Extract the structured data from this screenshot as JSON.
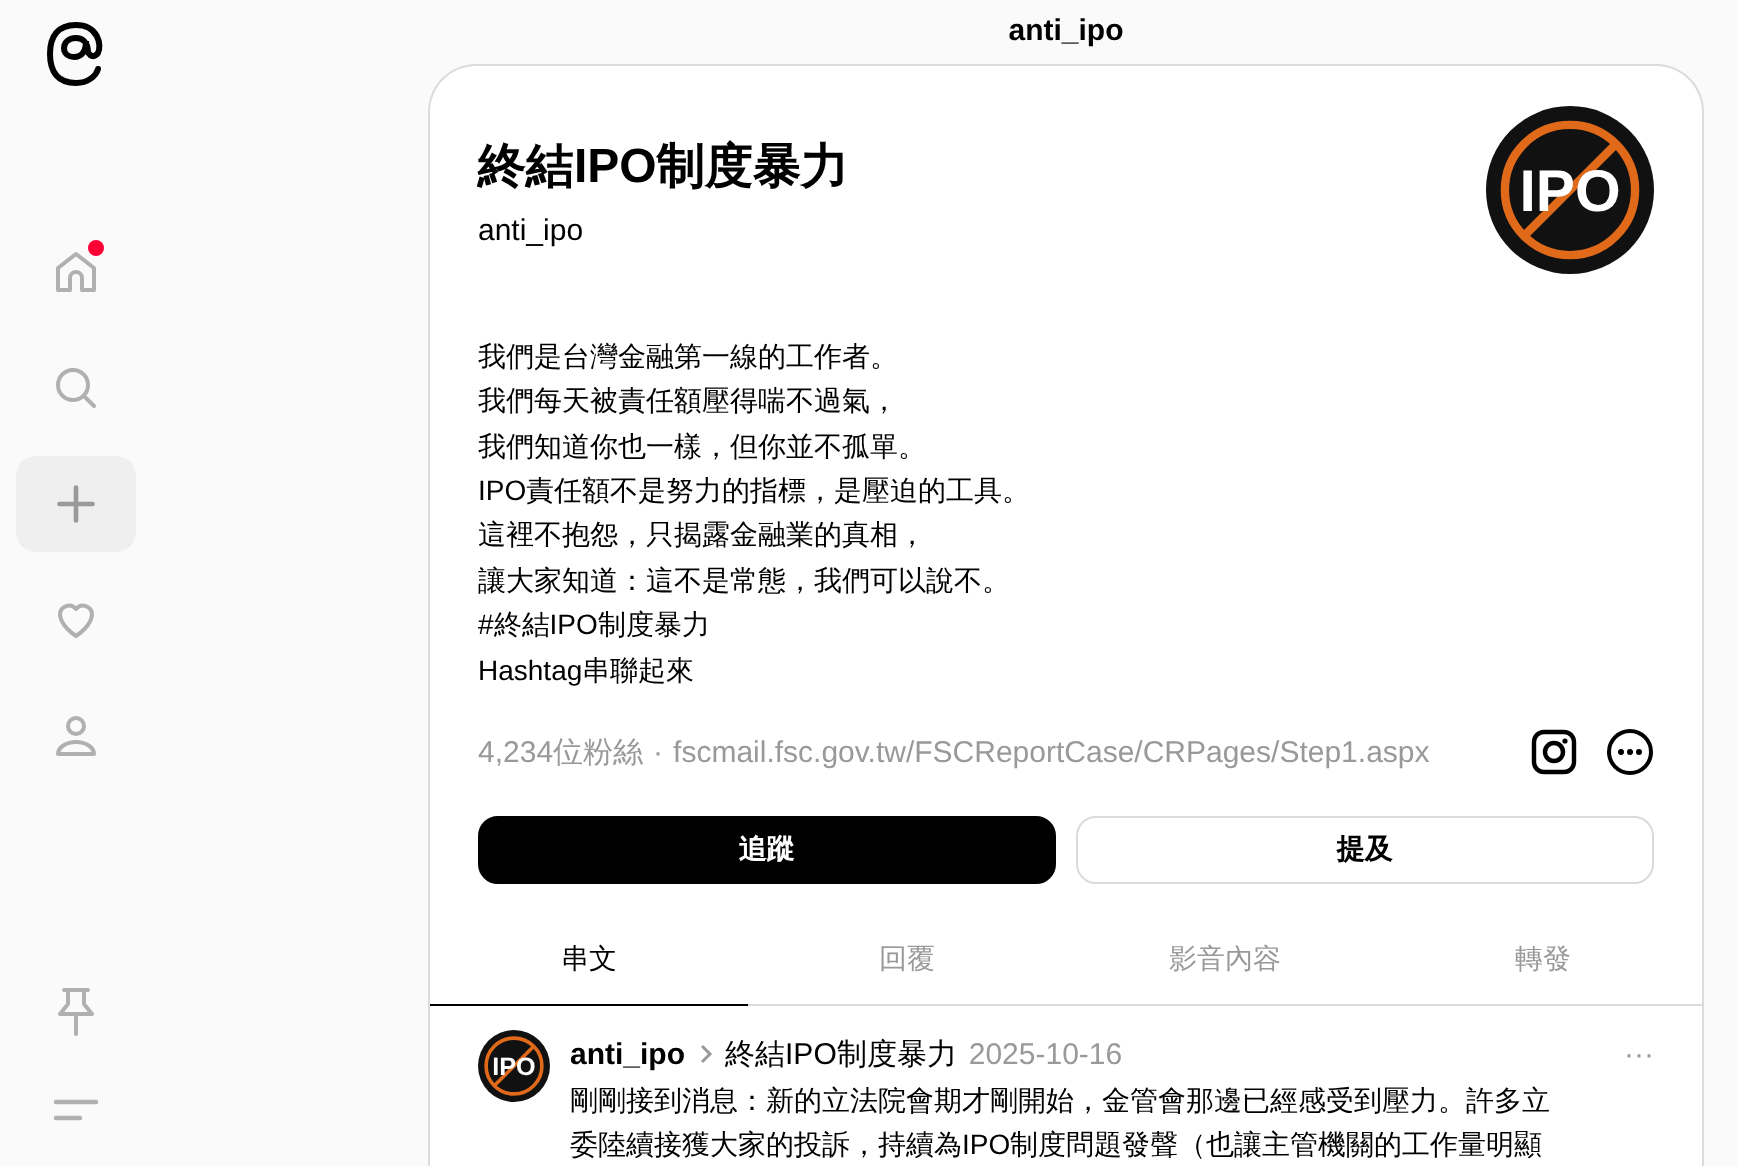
{
  "header": {
    "title": "anti_ipo"
  },
  "nav": [
    {
      "kind": "home",
      "notification": true,
      "hovered": false
    },
    {
      "kind": "search",
      "notification": false,
      "hovered": false
    },
    {
      "kind": "create",
      "notification": false,
      "hovered": true
    },
    {
      "kind": "activity",
      "notification": false,
      "hovered": false
    },
    {
      "kind": "profile",
      "notification": false,
      "hovered": false
    }
  ],
  "profile": {
    "name": "終結IPO制度暴力",
    "handle": "anti_ipo",
    "avatar_text": "IPO",
    "bio": [
      "我們是台灣金融第一線的工作者。",
      "我們每天被責任額壓得喘不過氣，",
      "我們知道你也一樣，但你並不孤單。",
      "IPO責任額不是努力的指標，是壓迫的工具。",
      "這裡不抱怨，只揭露金融業的真相，",
      "讓大家知道：這不是常態，我們可以說不。",
      "#終結IPO制度暴力",
      "Hashtag串聯起來"
    ],
    "followers": "4,234位粉絲",
    "separator": "·",
    "link": "fscmail.fsc.gov.tw/FSCReportCase/CRPages/Step1.aspx"
  },
  "buttons": [
    {
      "label": "追蹤",
      "kind": "primary"
    },
    {
      "label": "提及",
      "kind": "secondary"
    }
  ],
  "tabs": [
    {
      "label": "串文",
      "selected": true
    },
    {
      "label": "回覆",
      "selected": false
    },
    {
      "label": "影音內容",
      "selected": false
    },
    {
      "label": "轉發",
      "selected": false
    }
  ],
  "post": {
    "author": "anti_ipo",
    "topic": "終結IPO制度暴力",
    "date": "2025-10-16",
    "avatar_text": "IPO",
    "more": "···",
    "lines": [
      "剛剛接到消息：新的立法院會期才剛開始，金管會那邊已經感受到壓力。許多立",
      "委陸續接獲大家的投訴，持續為IPO制度問題發聲（也讓主管機關的工作量明顯"
    ]
  }
}
